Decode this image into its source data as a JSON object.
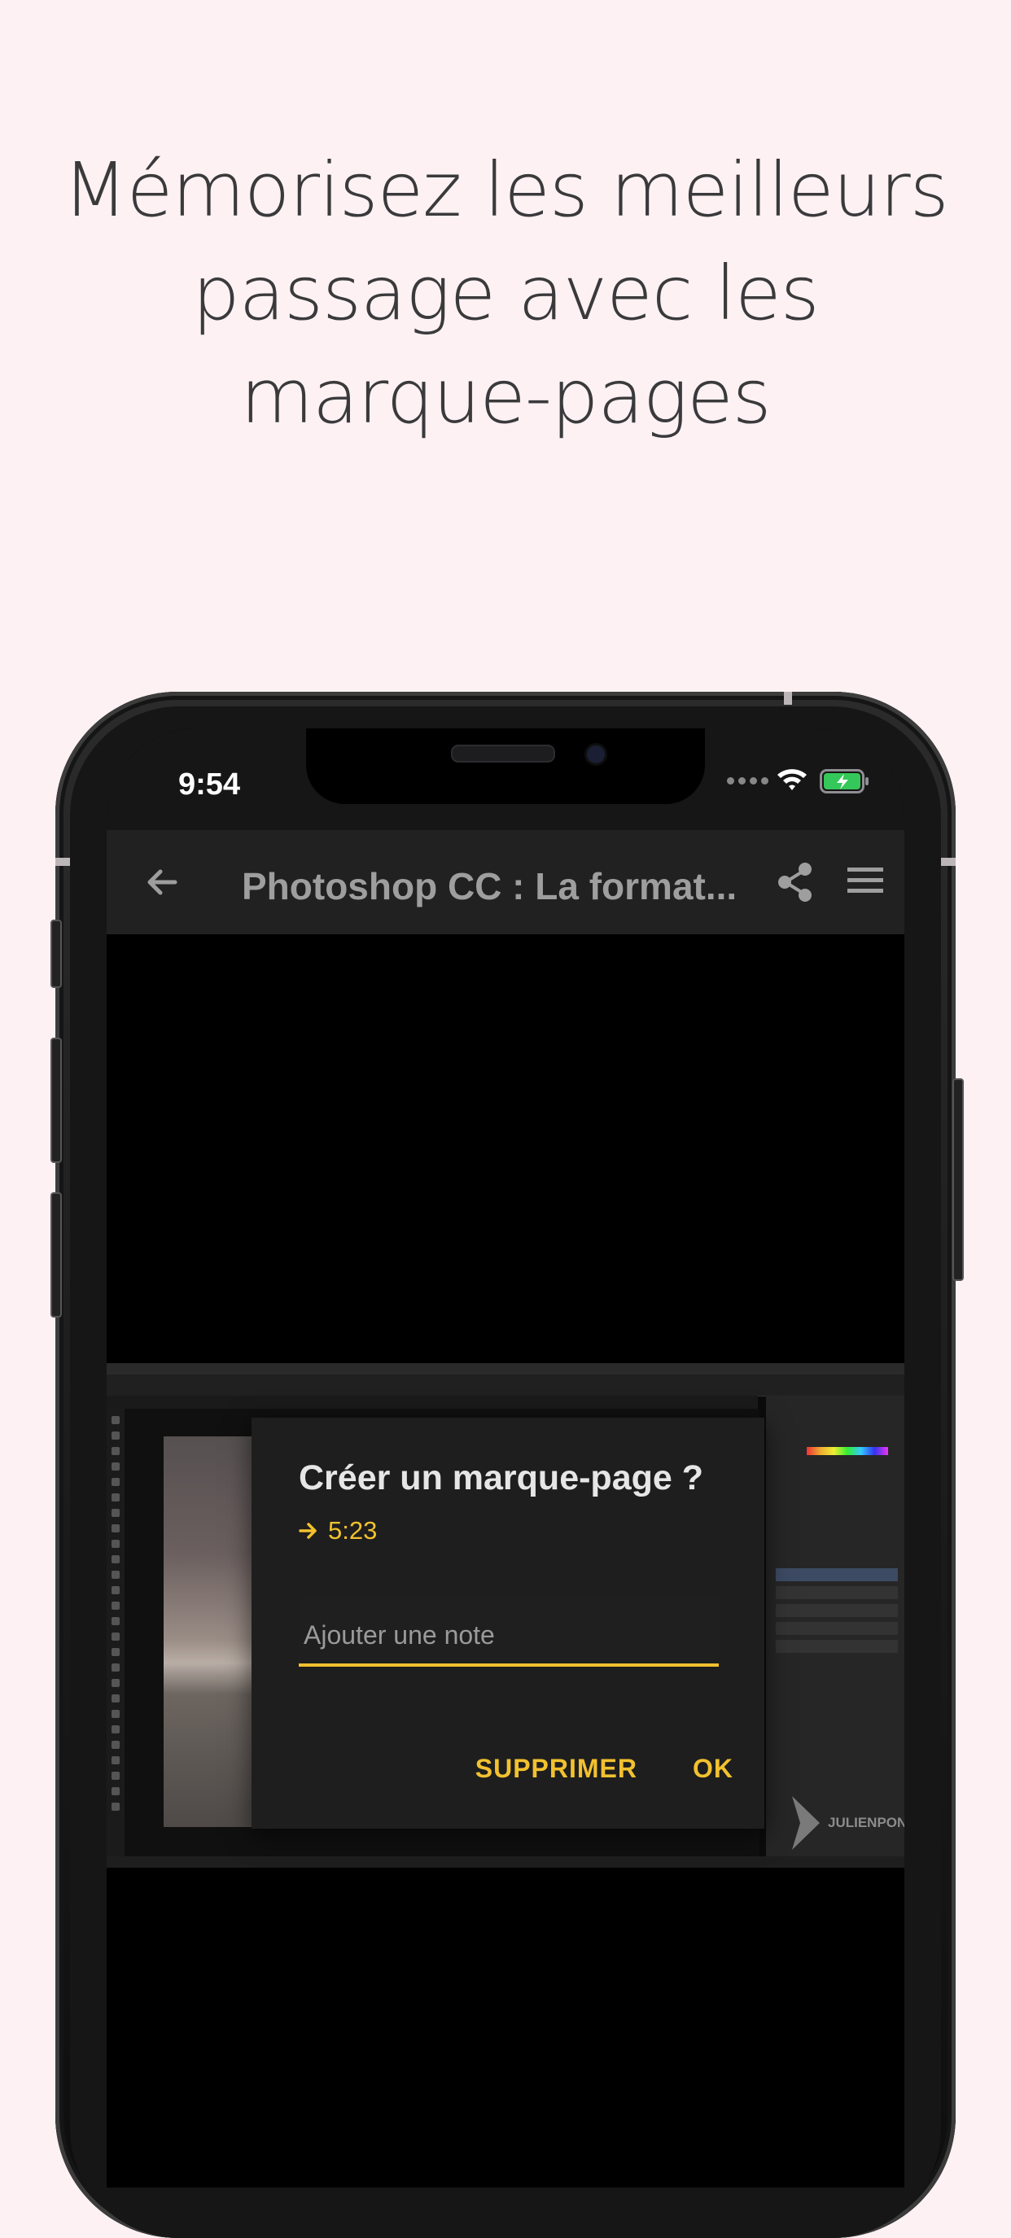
{
  "headline": {
    "lines": [
      "Mémorisez les meilleurs",
      "passage avec les",
      "marque-pages"
    ]
  },
  "status_bar": {
    "time": "9:54"
  },
  "app_bar": {
    "title": "Photoshop CC : La format...",
    "icons": [
      "arrow-back-icon",
      "share-icon",
      "menu-icon"
    ]
  },
  "dialog": {
    "title": "Créer un marque-page ?",
    "timestamp": "5:23",
    "note_placeholder": "Ajouter une note",
    "note_value": "",
    "delete_label": "SUPPRIMER",
    "ok_label": "OK"
  },
  "video": {
    "watermark": "JULIENPONS.COM"
  },
  "colors": {
    "background": "#fdf1f3",
    "accent": "#f2c12e",
    "app_bar": "#212121",
    "dialog": "#1e1e1e",
    "battery": "#34c759"
  }
}
